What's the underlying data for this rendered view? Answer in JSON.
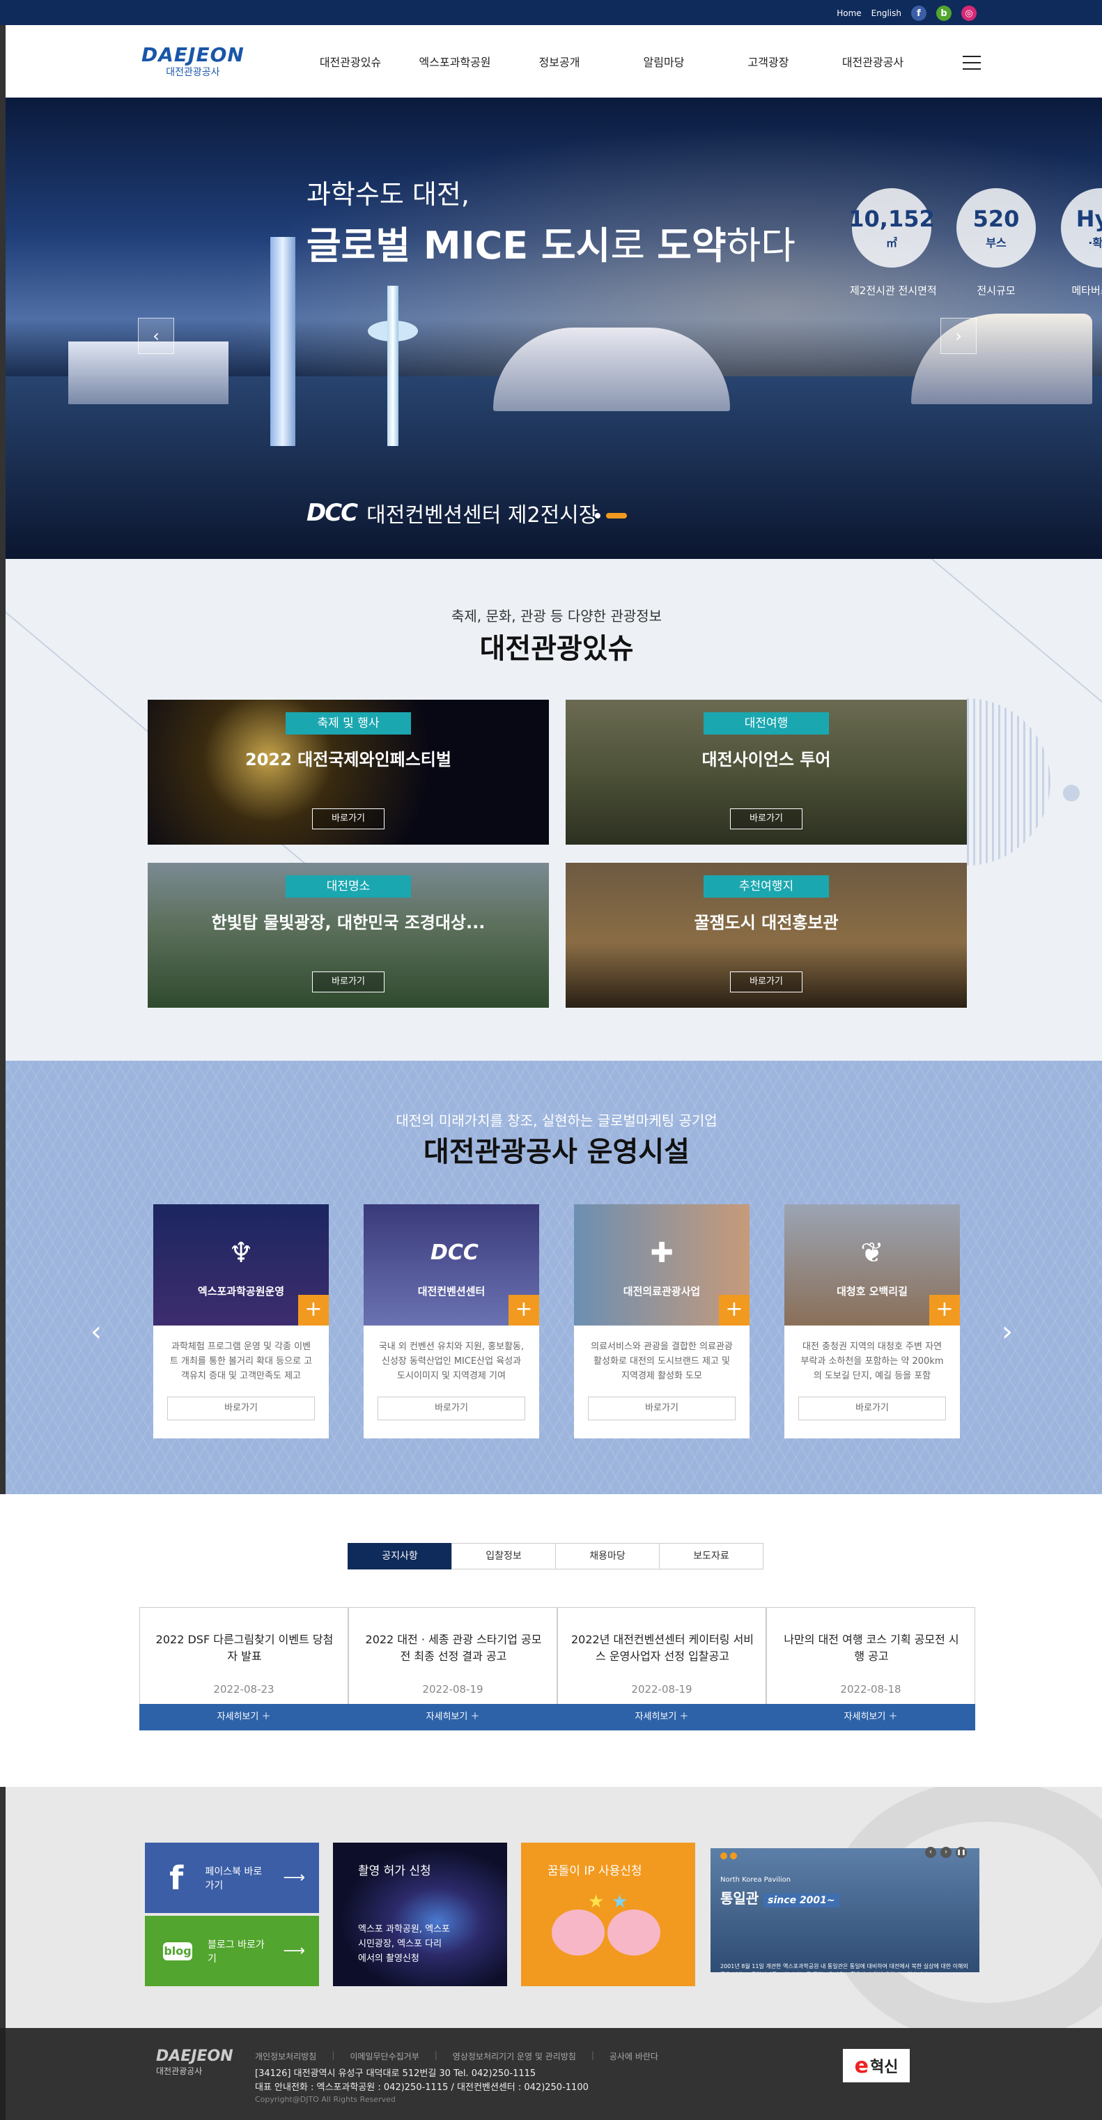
{
  "topbar": {
    "home": "Home",
    "english": "English",
    "facebook": "f",
    "blog": "b",
    "instagram": "◎"
  },
  "header": {
    "logo_en": "DAEJEON",
    "logo_ko": "대전관광공사",
    "nav": [
      "대전관광있슈",
      "엑스포과학공원",
      "정보공개",
      "알림마당",
      "고객광장",
      "대전관광공사"
    ]
  },
  "hero": {
    "line1": "과학수도 대전,",
    "line2_a": "글로벌 MICE ",
    "line2_b": "도시",
    "line2_c": "로 ",
    "line2_d": "도약",
    "line2_e": "하다",
    "stats": [
      {
        "value": "10,152",
        "unit": "㎡",
        "label": "제2전시관 전시면적"
      },
      {
        "value": "520",
        "unit": "부스",
        "label": "전시규모"
      },
      {
        "value": "Hyb",
        "unit": "·확장",
        "label": "메타버스 · 첨"
      }
    ],
    "caption_mark": "DCC",
    "caption": "대전컨벤션센터 제2전시장",
    "prev": "‹",
    "next": "›"
  },
  "issue": {
    "subtitle": "축제, 문화, 관광 등 다양한 관광정보",
    "title": "대전관광있슈",
    "cards": [
      {
        "tag": "축제 및 행사",
        "title": "2022 대전국제와인페스티벌",
        "button": "바로가기"
      },
      {
        "tag": "대전여행",
        "title": "대전사이언스 투어",
        "button": "바로가기"
      },
      {
        "tag": "대전명소",
        "title": "한빛탑 물빛광장, 대한민국 조경대상...",
        "button": "바로가기"
      },
      {
        "tag": "추천여행지",
        "title": "꿀잼도시 대전홍보관",
        "button": "바로가기"
      }
    ]
  },
  "facilities": {
    "subtitle": "대전의 미래가치를 창조, 실현하는 글로벌마케팅 공기업",
    "title": "대전관광공사 운영시설",
    "items": [
      {
        "name": "엑스포과학공원운영",
        "icon": "tower-icon",
        "desc": "과학체험 프로그램 운영 및 각종 이벤트 개최를 통한 볼거리 확대 등으로 고객유치 증대 및 고객만족도 제고",
        "button": "바로가기"
      },
      {
        "name": "대전컨벤션센터",
        "icon": "dcc-icon",
        "desc": "국내 외 컨벤션 유치와 지원, 홍보활동, 신성장 동력산업인 MICE산업 육성과 도시이미지 및 지역경제 기여",
        "button": "바로가기"
      },
      {
        "name": "대전의료관광사업",
        "icon": "ambulance-icon",
        "desc": "의료서비스와 관광을 결합한 의료관광 활성화로 대전의 도시브랜드 제고 및 지역경제 활성화 도모",
        "button": "바로가기"
      },
      {
        "name": "대청호 오백리길",
        "icon": "wheat-icon",
        "desc": "대전 충청권 지역의 대청호 주변 자연부락과 소하천을 포함하는 약 200km의 도보길 단지, 예길 등을 포함",
        "button": "바로가기"
      }
    ],
    "prev": "‹",
    "next": "›",
    "plus": "+"
  },
  "notice": {
    "tabs": [
      "공지사항",
      "입찰정보",
      "채용마당",
      "보도자료"
    ],
    "items": [
      {
        "title": "2022 DSF 다른그림찾기 이벤트 당첨자 발표",
        "date": "2022-08-23",
        "button": "자세히보기 ＋"
      },
      {
        "title": "2022 대전 · 세종 관광 스타기업 공모전 최종 선정 결과 공고",
        "date": "2022-08-19",
        "button": "자세히보기 ＋"
      },
      {
        "title": "2022년 대전컨벤션센터 케이터링 서비스 운영사업자 선정 입찰공고",
        "date": "2022-08-19",
        "button": "자세히보기 ＋"
      },
      {
        "title": "나만의 대전 여행 코스 기획 공모전 시행 공고",
        "date": "2022-08-18",
        "button": "자세히보기 ＋"
      }
    ]
  },
  "links": {
    "facebook_icon": "f",
    "facebook_label": "페이스북 바로가기",
    "blog_icon": "blog",
    "blog_label": "블로그 바로가기",
    "arrow": "⟶",
    "film_title": "촬영 허가 신청",
    "film_text": "엑스포 과학공원, 엑스포\n시민광장, 엑스포 다리\n에서의 촬영신청",
    "ip_title": "꿈돌이 IP 사용신청",
    "pavilion_small": "North Korea Pavilion",
    "pavilion_title": "통일관",
    "pavilion_since": "since 2001~",
    "pavilion_text": "2001년 8월 11일 개관한 엑스포과학공원 내 통일관은 통일에 대비하여 대전에서 북한 실상에 대한 이해의 폭을 넓히고, 통일의지를 고취시키는 등 통일교육장으로 활용하기 위해 운영되고 있습니다."
  },
  "footer": {
    "logo_en": "DAEJEON",
    "logo_ko": "대전관광공사",
    "links": [
      "개인정보처리방침",
      "이메일무단수집거부",
      "영상정보처리기기 운영 및 관리방침",
      "공사에 바란다"
    ],
    "address": "[34126] 대전광역시 유성구 대덕대로 512번길 30 Tel. 042)250-1115",
    "phones": "대표 안내전화 : 엑스포과학공원 : 042)250-1115 / 대전컨벤션센터 : 042)250-1100",
    "copyright": "Copyright@DJTO All Rights Reserved",
    "badge_e": "e",
    "badge_text": "혁신"
  }
}
